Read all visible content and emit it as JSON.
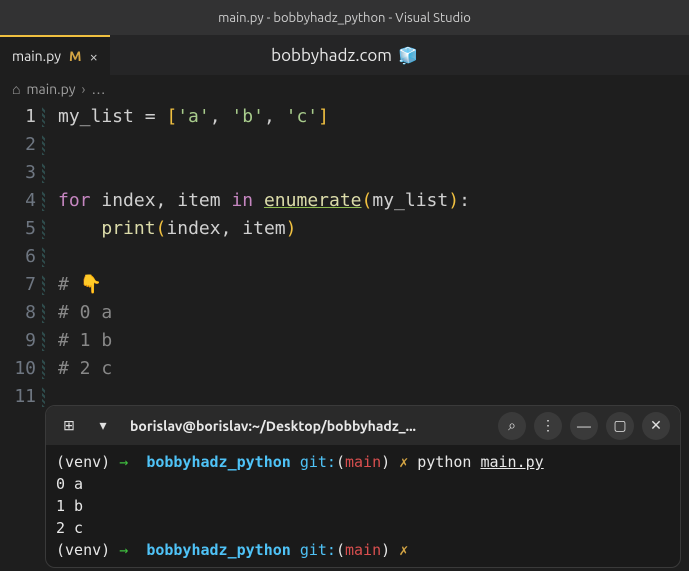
{
  "window": {
    "title": "main.py - bobbyhadz_python - Visual Studio"
  },
  "tab": {
    "name": "main.py",
    "modified": "M",
    "close": "×"
  },
  "watermark": {
    "text": "bobbyhadz.com",
    "icon": "🧊"
  },
  "breadcrumb": {
    "icon": "⌂",
    "file": "main.py",
    "sep": "›",
    "ellipsis": "…"
  },
  "code": {
    "lines": [
      {
        "n": "1",
        "tokens": [
          [
            "var",
            "my_list"
          ],
          [
            "op",
            " = "
          ],
          [
            "punc",
            "["
          ],
          [
            "str",
            "'a'"
          ],
          [
            "op",
            ", "
          ],
          [
            "str",
            "'b'"
          ],
          [
            "op",
            ", "
          ],
          [
            "str",
            "'c'"
          ],
          [
            "punc",
            "]"
          ]
        ]
      },
      {
        "n": "2",
        "tokens": []
      },
      {
        "n": "3",
        "tokens": []
      },
      {
        "n": "4",
        "tokens": [
          [
            "key",
            "for"
          ],
          [
            "op",
            " "
          ],
          [
            "var",
            "index"
          ],
          [
            "op",
            ", "
          ],
          [
            "var",
            "item"
          ],
          [
            "op",
            " "
          ],
          [
            "key",
            "in"
          ],
          [
            "op",
            " "
          ],
          [
            "bif",
            "enumerate"
          ],
          [
            "punc",
            "("
          ],
          [
            "var",
            "my_list"
          ],
          [
            "punc",
            ")"
          ],
          [
            "op",
            ":"
          ]
        ]
      },
      {
        "n": "5",
        "tokens": [
          [
            "op",
            "    "
          ],
          [
            "func",
            "print"
          ],
          [
            "punc",
            "("
          ],
          [
            "var",
            "index"
          ],
          [
            "op",
            ", "
          ],
          [
            "var",
            "item"
          ],
          [
            "punc",
            ")"
          ]
        ]
      },
      {
        "n": "6",
        "tokens": []
      },
      {
        "n": "7",
        "tokens": [
          [
            "cmt2",
            "# "
          ],
          [
            "emoji",
            "👇"
          ]
        ]
      },
      {
        "n": "8",
        "tokens": [
          [
            "cmt2",
            "# 0 a"
          ]
        ]
      },
      {
        "n": "9",
        "tokens": [
          [
            "cmt2",
            "# 1 b"
          ]
        ]
      },
      {
        "n": "10",
        "tokens": [
          [
            "cmt2",
            "# 2 c"
          ]
        ]
      },
      {
        "n": "11",
        "tokens": []
      }
    ]
  },
  "terminal": {
    "header": {
      "newtab": "⊞",
      "dropdown": "▾",
      "title": "borislav@borislav:~/Desktop/bobbyhadz_...",
      "search": "⌕",
      "menu": "⋮",
      "min": "—",
      "max": "▢",
      "close": "✕"
    },
    "lines": [
      {
        "seg": [
          [
            "venv",
            "(venv) "
          ],
          [
            "arrow",
            "→  "
          ],
          [
            "dir",
            "bobbyhadz_python"
          ],
          [
            "op",
            " "
          ],
          [
            "git",
            "git:"
          ],
          [
            "paren",
            "("
          ],
          [
            "branch",
            "main"
          ],
          [
            "paren",
            ") "
          ],
          [
            "x",
            "✗ "
          ],
          [
            "cmd",
            "python "
          ],
          [
            "file",
            "main.py"
          ]
        ]
      },
      {
        "seg": [
          [
            "out",
            "0 a"
          ]
        ]
      },
      {
        "seg": [
          [
            "out",
            "1 b"
          ]
        ]
      },
      {
        "seg": [
          [
            "out",
            "2 c"
          ]
        ]
      },
      {
        "seg": [
          [
            "venv",
            "(venv) "
          ],
          [
            "arrow",
            "→  "
          ],
          [
            "dir",
            "bobbyhadz_python"
          ],
          [
            "op",
            " "
          ],
          [
            "git",
            "git:"
          ],
          [
            "paren",
            "("
          ],
          [
            "branch",
            "main"
          ],
          [
            "paren",
            ") "
          ],
          [
            "x",
            "✗ "
          ]
        ]
      }
    ]
  }
}
